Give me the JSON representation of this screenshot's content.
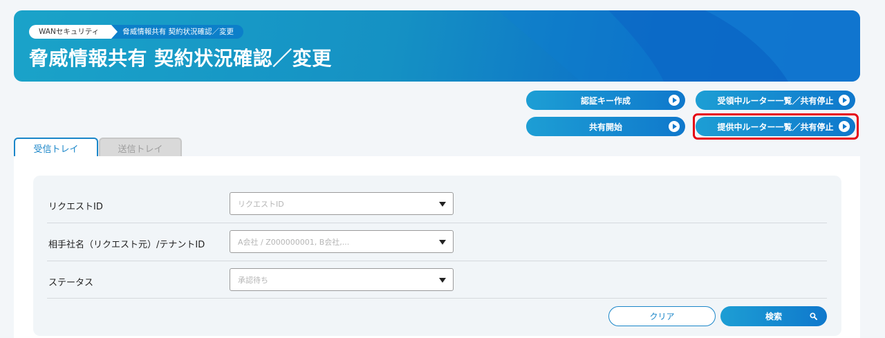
{
  "header": {
    "breadcrumb": [
      "WANセキュリティ",
      "脅威情報共有 契約状況確認／変更"
    ],
    "title": "脅威情報共有 契約状況確認／変更"
  },
  "actions": {
    "create_auth_key": "認証キー作成",
    "received_router_list": "受領中ルーター一覧／共有停止",
    "start_sharing": "共有開始",
    "provided_router_list": "提供中ルーター一覧／共有停止"
  },
  "tabs": [
    {
      "label": "受信トレイ",
      "active": true
    },
    {
      "label": "送信トレイ",
      "active": false
    }
  ],
  "filters": {
    "request_id": {
      "label": "リクエストID",
      "placeholder": "リクエストID"
    },
    "partner": {
      "label": "相手社名（リクエスト元）/テナントID",
      "placeholder": "A会社 / Z000000001, B会社,..."
    },
    "status": {
      "label": "ステータス",
      "placeholder": "承認待ち"
    }
  },
  "buttons": {
    "clear": "クリア",
    "search": "検索"
  },
  "colors": {
    "accent": "#0f78cc",
    "highlight": "#e60012",
    "banner_start": "#1aa3c9",
    "banner_end": "#0a66c8"
  },
  "icons": [
    "play-circle-icon",
    "search-icon",
    "dropdown-caret-icon"
  ]
}
